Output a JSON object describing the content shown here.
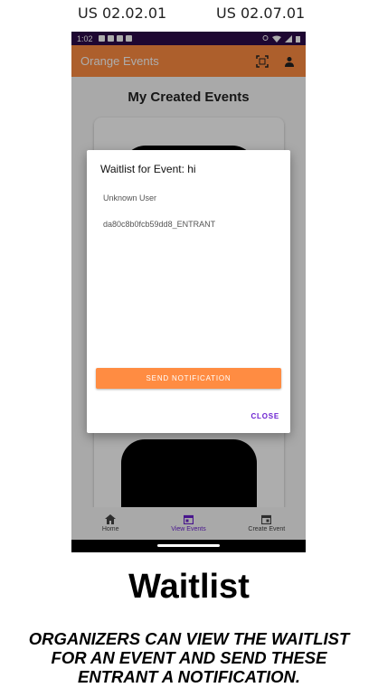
{
  "stories": {
    "left": "US 02.02.01",
    "right": "US 02.07.01"
  },
  "status_bar": {
    "time": "1:02"
  },
  "app_bar": {
    "title": "Orange Events",
    "icons": [
      "qr-scanner-icon",
      "person-icon"
    ],
    "color": "#ff8c42"
  },
  "main": {
    "section_title": "My Created Events"
  },
  "dialog": {
    "title": "Waitlist for Event: hi",
    "items": [
      "Unknown User",
      "da80c8b0fcb59dd8_ENTRANT"
    ],
    "send_label": "SEND NOTIFICATION",
    "close_label": "CLOSE"
  },
  "bottom_nav": {
    "items": [
      {
        "label": "Home",
        "icon": "home-icon"
      },
      {
        "label": "View Events",
        "icon": "calendar-icon",
        "active": true
      },
      {
        "label": "Create Event",
        "icon": "calendar-add-icon"
      }
    ],
    "active_color": "#6a1fd0"
  },
  "caption": {
    "title": "Waitlist",
    "text": "ORGANIZERS CAN VIEW THE WAITLIST FOR AN EVENT AND SEND THESE ENTRANT A NOTIFICATION."
  }
}
